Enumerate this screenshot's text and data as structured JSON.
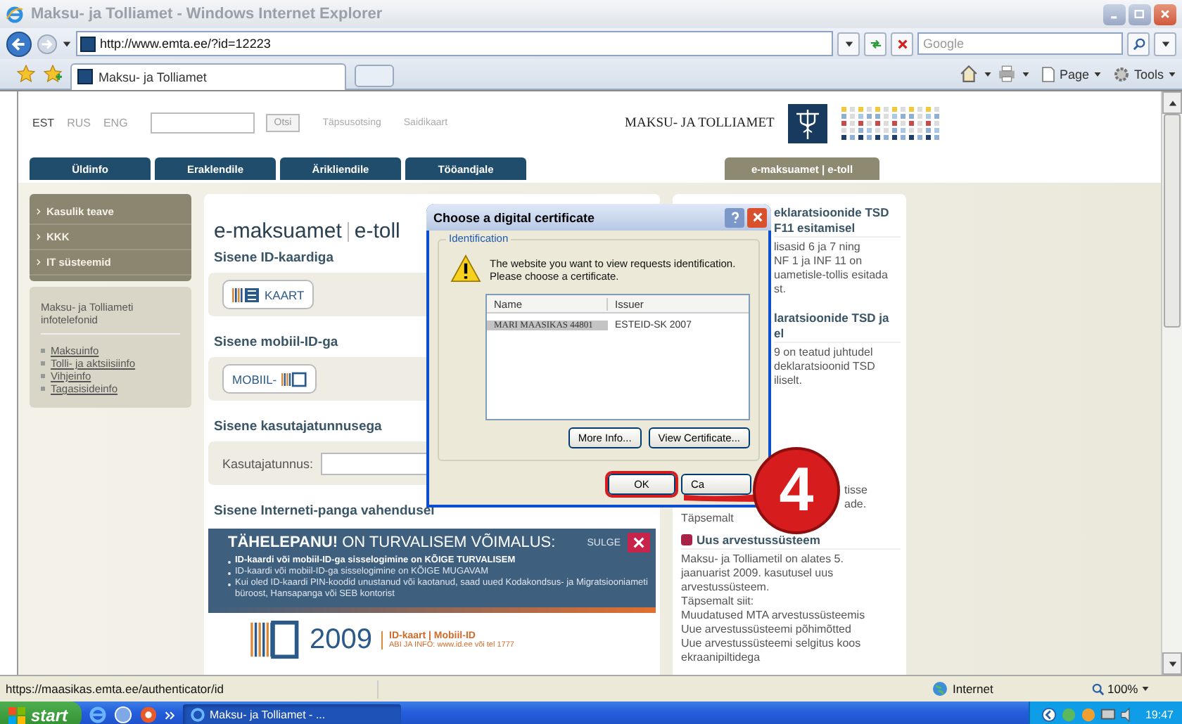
{
  "window": {
    "title": "Maksu- ja Tolliamet - Windows Internet Explorer"
  },
  "address_bar": {
    "url": "http://www.emta.ee/?id=12223",
    "search_placeholder": "Google"
  },
  "tabs": [
    {
      "label": "Maksu- ja Tolliamet",
      "selected": true
    }
  ],
  "command_bar": [
    "Page",
    "Tools"
  ],
  "page": {
    "languages": [
      {
        "label": "EST",
        "selected": true
      },
      {
        "label": "RUS",
        "selected": false
      },
      {
        "label": "ENG",
        "selected": false
      }
    ],
    "search_button": "Otsi",
    "header_links": [
      "Täpsusotsing",
      "Saidikaart"
    ],
    "logo_text": "MAKSU- JA TOLLIAMET",
    "nav": [
      {
        "label": "Üldinfo",
        "kind": "main",
        "selected": false
      },
      {
        "label": "Eraklendile",
        "kind": "main",
        "selected": false
      },
      {
        "label": "Ärikliendile",
        "kind": "main",
        "selected": false
      },
      {
        "label": "Tööandjale",
        "kind": "main",
        "selected": false
      },
      {
        "label": "e-maksuamet | e-toll",
        "kind": "service",
        "selected": true
      }
    ],
    "sidebar_menu": [
      "Kasulik teave",
      "KKK",
      "IT süsteemid"
    ],
    "info_box": {
      "title": "Maksu- ja Tolliameti infotelefonid",
      "links": [
        "Maksuinfo",
        "Tolli- ja aktsiisiinfo",
        "Vihjeinfo",
        "Tagasisideinfo"
      ]
    },
    "main": {
      "title": "e-maksuamet",
      "title_2": "e-toll",
      "sections": [
        {
          "kind": "id_card",
          "heading": "Sisene ID-kaardiga",
          "button": "KAART"
        },
        {
          "kind": "mobile_id",
          "heading": "Sisene mobiil-ID-ga",
          "button": "MOBIIL-"
        },
        {
          "kind": "username",
          "heading": "Sisene kasutajatunnusega",
          "label": "Kasutajatunnus:"
        },
        {
          "kind": "bank",
          "heading": "Sisene Interneti-panga vahendusel"
        }
      ]
    },
    "banner": {
      "title_bold": "TÄHELEPANU!",
      "title_rest": "ON TURVALISEM VÕIMALUS:",
      "close_label": "SULGE",
      "bullets": [
        {
          "text": "ID-kaardi või mobiil-ID-ga sisselogimine on KÕIGE TURVALISEM",
          "bold": true
        },
        {
          "text": "ID-kaardi või mobiil-ID-ga sisselogimine on KÕIGE MUGAVAM",
          "bold": false
        },
        {
          "text": "Kui oled ID-kaardi PIN-koodid unustanud või kaotanud, saad uued Kodakondsus- ja Migratsiooniameti büroost, Hansapanga või SEB kontorist",
          "bold": false
        }
      ],
      "year": "2009",
      "brand": "ID-kaart | Mobiil-ID",
      "contact": "ABI JA INFO: www.id.ee või tel 1777"
    },
    "news": [
      {
        "kind": "under_dialog",
        "heading_lines": [
          "eklaratsioonide TSD",
          "F11 esitamisel"
        ],
        "body_lines": [
          "lisasid 6 ja 7 ning",
          "NF 1 ja INF 11 on",
          "uametisle-tollis esitada",
          "st."
        ]
      },
      {
        "kind": "under_dialog",
        "heading_lines": [
          "laratsioonide TSD ja",
          "el"
        ],
        "body_lines": [
          "9 on teatud juhtudel",
          "deklaratsioonid TSD",
          "iliselt."
        ]
      },
      {
        "kind": "under_marker",
        "body_lines": [
          "tisse",
          "ade."
        ],
        "link": "Täpsemalt"
      },
      {
        "kind": "full",
        "heading_lines": [
          "Uus arvestussüsteem"
        ],
        "body_lines": [
          "Maksu- ja Tolliametil on alates 5.",
          "jaanuarist 2009. kasutusel uus",
          "arvestussüsteem.",
          "Täpsemalt siit:"
        ],
        "links": [
          "Muudatused MTA arvestussüsteemis",
          "Uue arvestussüsteemi põhimõtted",
          "Uue arvestussüsteemi selgitus koos ekraanipiltidega"
        ]
      }
    ]
  },
  "dialog": {
    "title": "Choose a digital certificate",
    "group": "Identification",
    "message": "The website you want to view requests identification. Please choose a certificate.",
    "columns": [
      "Name",
      "Issuer"
    ],
    "certificates": [
      {
        "name": "MARI MAASIKAS 44801",
        "issuer": "ESTEID-SK 2007",
        "selected": true
      }
    ],
    "buttons": [
      "More Info...",
      "View Certificate..."
    ],
    "ok": {
      "label": "OK",
      "highlighted": true
    },
    "cancel": "Ca"
  },
  "step_marker": "4",
  "status_bar": {
    "url": "https://maasikas.emta.ee/authenticator/id",
    "zone": "Internet",
    "zoom": "100%"
  },
  "taskbar": {
    "start": "start",
    "tasks": [
      {
        "label": "Maksu- ja Tolliamet - ...",
        "selected": true
      }
    ],
    "clock": "19:47"
  }
}
